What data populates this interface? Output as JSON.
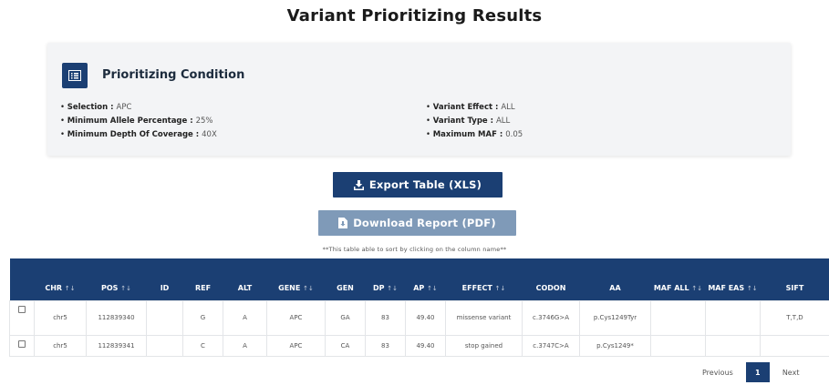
{
  "page": {
    "title": "Variant Prioritizing Results"
  },
  "condition": {
    "title": "Prioritizing Condition",
    "left": [
      {
        "label": "Selection : ",
        "value": "APC"
      },
      {
        "label": "Minimum Allele Percentage : ",
        "value": "25%"
      },
      {
        "label": "Minimum Depth Of Coverage : ",
        "value": "40X"
      }
    ],
    "right": [
      {
        "label": "Variant Effect : ",
        "value": "ALL"
      },
      {
        "label": "Variant Type : ",
        "value": "ALL"
      },
      {
        "label": "Maximum MAF : ",
        "value": "0.05"
      }
    ]
  },
  "actions": {
    "export_label": "Export Table (XLS)",
    "report_label": "Download Report (PDF)"
  },
  "table": {
    "note": "**This table able to sort by clicking on the column name**",
    "columns": [
      "CHR",
      "POS",
      "ID",
      "REF",
      "ALT",
      "GENE",
      "GEN",
      "DP",
      "AP",
      "EFFECT",
      "CODON",
      "AA",
      "MAF ALL",
      "MAF EAS",
      "SIFT"
    ],
    "rows": [
      {
        "chr": "chr5",
        "pos": "112839340",
        "id": "",
        "ref": "G",
        "alt": "A",
        "gene": "APC",
        "gen": "GA",
        "dp": "83",
        "ap": "49.40",
        "effect": "missense variant",
        "codon": "c.3746G>A",
        "aa": "p.Cys1249Tyr",
        "maf_all": "",
        "maf_eas": "",
        "sift": "T,T,D"
      },
      {
        "chr": "chr5",
        "pos": "112839341",
        "id": "",
        "ref": "C",
        "alt": "A",
        "gene": "APC",
        "gen": "CA",
        "dp": "83",
        "ap": "49.40",
        "effect": "stop gained",
        "codon": "c.3747C>A",
        "aa": "p.Cys1249*",
        "maf_all": "",
        "maf_eas": "",
        "sift": ""
      }
    ]
  },
  "pager": {
    "previous": "Previous",
    "current": "1",
    "next": "Next"
  },
  "icons": {
    "condition": "list-icon",
    "export": "download-icon",
    "report": "file-download-icon",
    "sort": "sort-arrows-icon"
  },
  "colors": {
    "primary": "#1b3f73",
    "secondary": "#7f9ab8",
    "panel": "#f3f4f6"
  }
}
